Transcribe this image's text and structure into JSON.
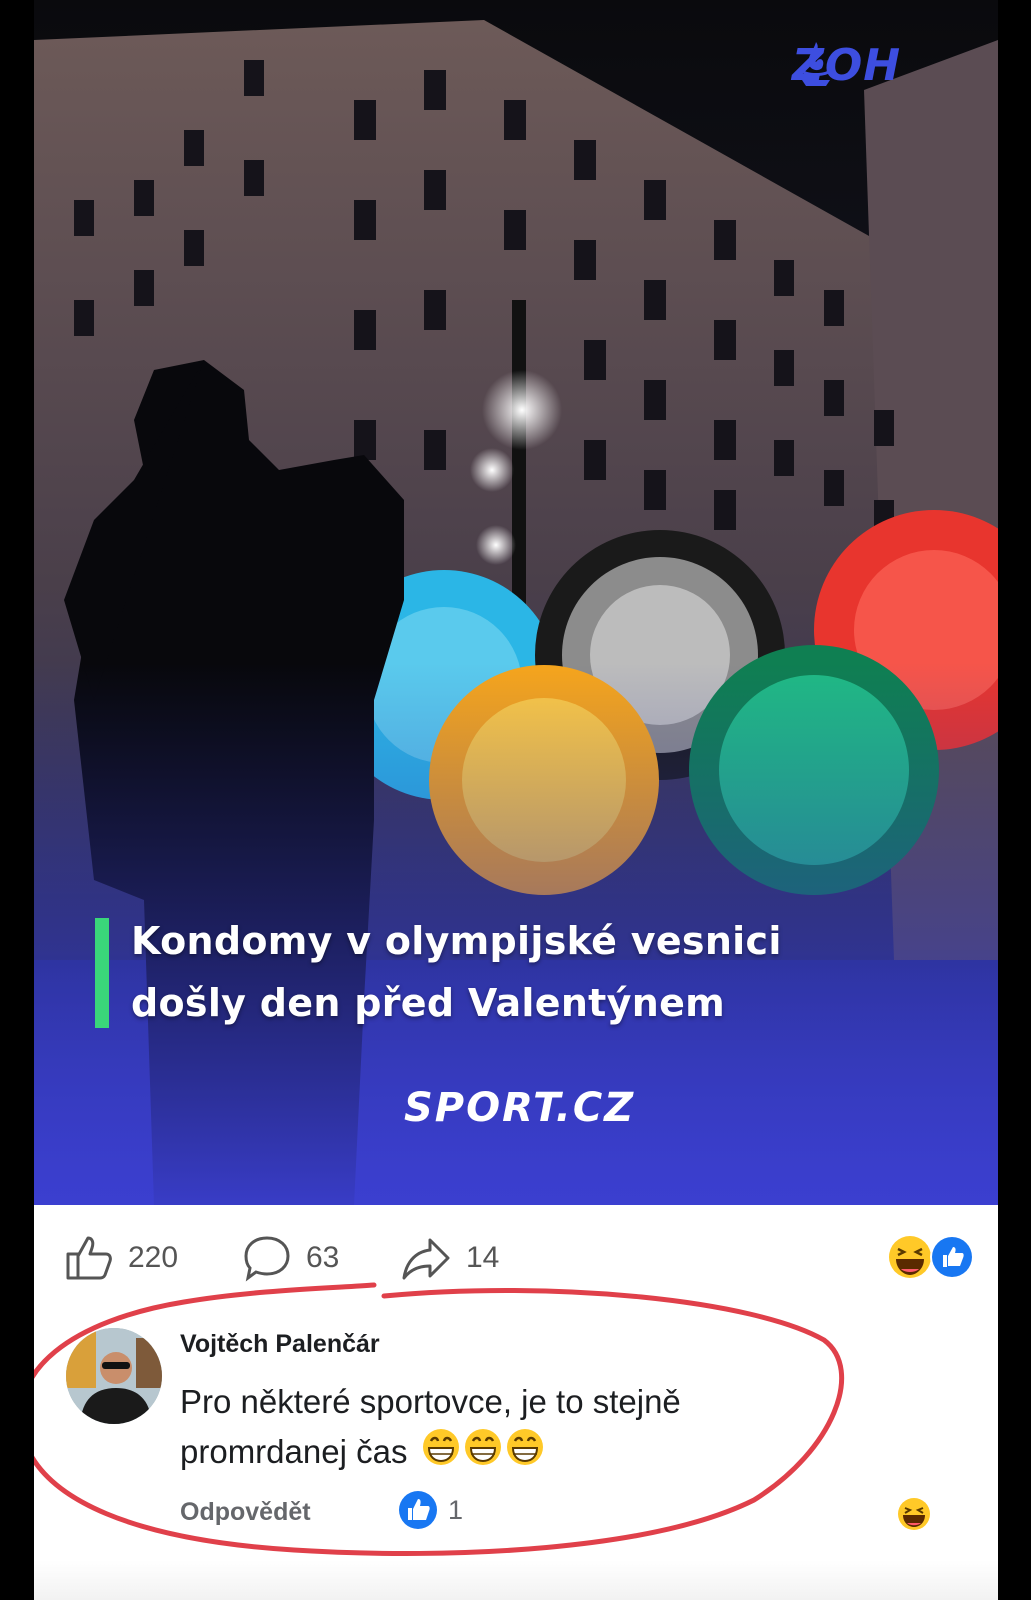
{
  "post": {
    "image": {
      "brand_badge": "ZOH",
      "headline_line1": "Kondomy v olympijské vesnici",
      "headline_line2": "došly den před Valentýnem",
      "source_logo": "SPORT.CZ",
      "headline_bar_color": "#3ad67a",
      "ring_colors": [
        "#2bb6e6",
        "#1a1a1a",
        "#e8352e",
        "#f6a51c",
        "#17a874"
      ]
    },
    "stats": {
      "likes": "220",
      "comments": "63",
      "shares": "14"
    },
    "reactions_summary": [
      "haha-emoji-icon",
      "like-reaction-icon"
    ]
  },
  "comment": {
    "author": "Vojtěch Palenčár",
    "text": "Pro některé sportovce, je to stejně promrdanej čas",
    "emojis": [
      "grinning-emoji-icon",
      "grinning-emoji-icon",
      "grinning-emoji-icon"
    ],
    "reply_label": "Odpovědět",
    "like_count": "1",
    "reaction_icon": "haha-emoji-icon"
  },
  "annotation": {
    "color": "#e0404a"
  }
}
